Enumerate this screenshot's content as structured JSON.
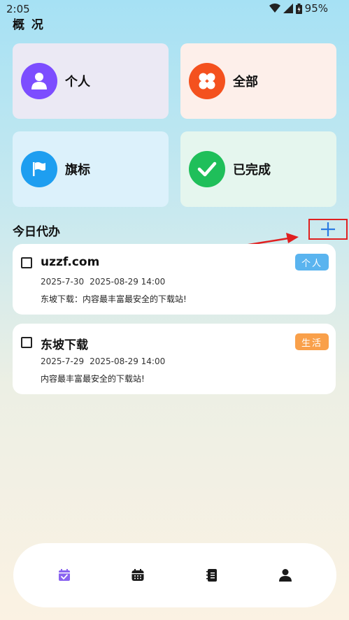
{
  "status_bar": {
    "time": "2:05",
    "battery": "95%"
  },
  "page": {
    "title": "概 况"
  },
  "tiles": [
    {
      "label": "个人",
      "color": "#7c4dff",
      "bg": "#ebe9f4"
    },
    {
      "label": "全部",
      "color": "#f4511e",
      "bg": "#fdefea"
    },
    {
      "label": "旗标",
      "color": "#1e9ef0",
      "bg": "#dcf1fb"
    },
    {
      "label": "已完成",
      "color": "#1fbf5a",
      "bg": "#e5f6ee"
    }
  ],
  "today": {
    "title": "今日代办",
    "add_icon": "plus-icon"
  },
  "tasks": [
    {
      "title": "uzzf.com",
      "start": "2025-7-30",
      "due": "2025-08-29 14:00",
      "desc": "东坡下载：内容最丰富最安全的下载站!",
      "tag": "个人",
      "tag_color": "#5ab4ef"
    },
    {
      "title": "东坡下载",
      "start": "2025-7-29",
      "due": "2025-08-29 14:00",
      "desc": "内容最丰富最安全的下载站!",
      "tag": "生活",
      "tag_color": "#f9a04a"
    }
  ],
  "nav": [
    {
      "icon": "calendar-check-icon",
      "active": true
    },
    {
      "icon": "calendar-icon",
      "active": false
    },
    {
      "icon": "notebook-icon",
      "active": false
    },
    {
      "icon": "person-icon",
      "active": false
    }
  ],
  "colors": {
    "accent": "#7c4dff",
    "annotation_red": "#e02020",
    "plus_blue": "#2a7ae2"
  }
}
